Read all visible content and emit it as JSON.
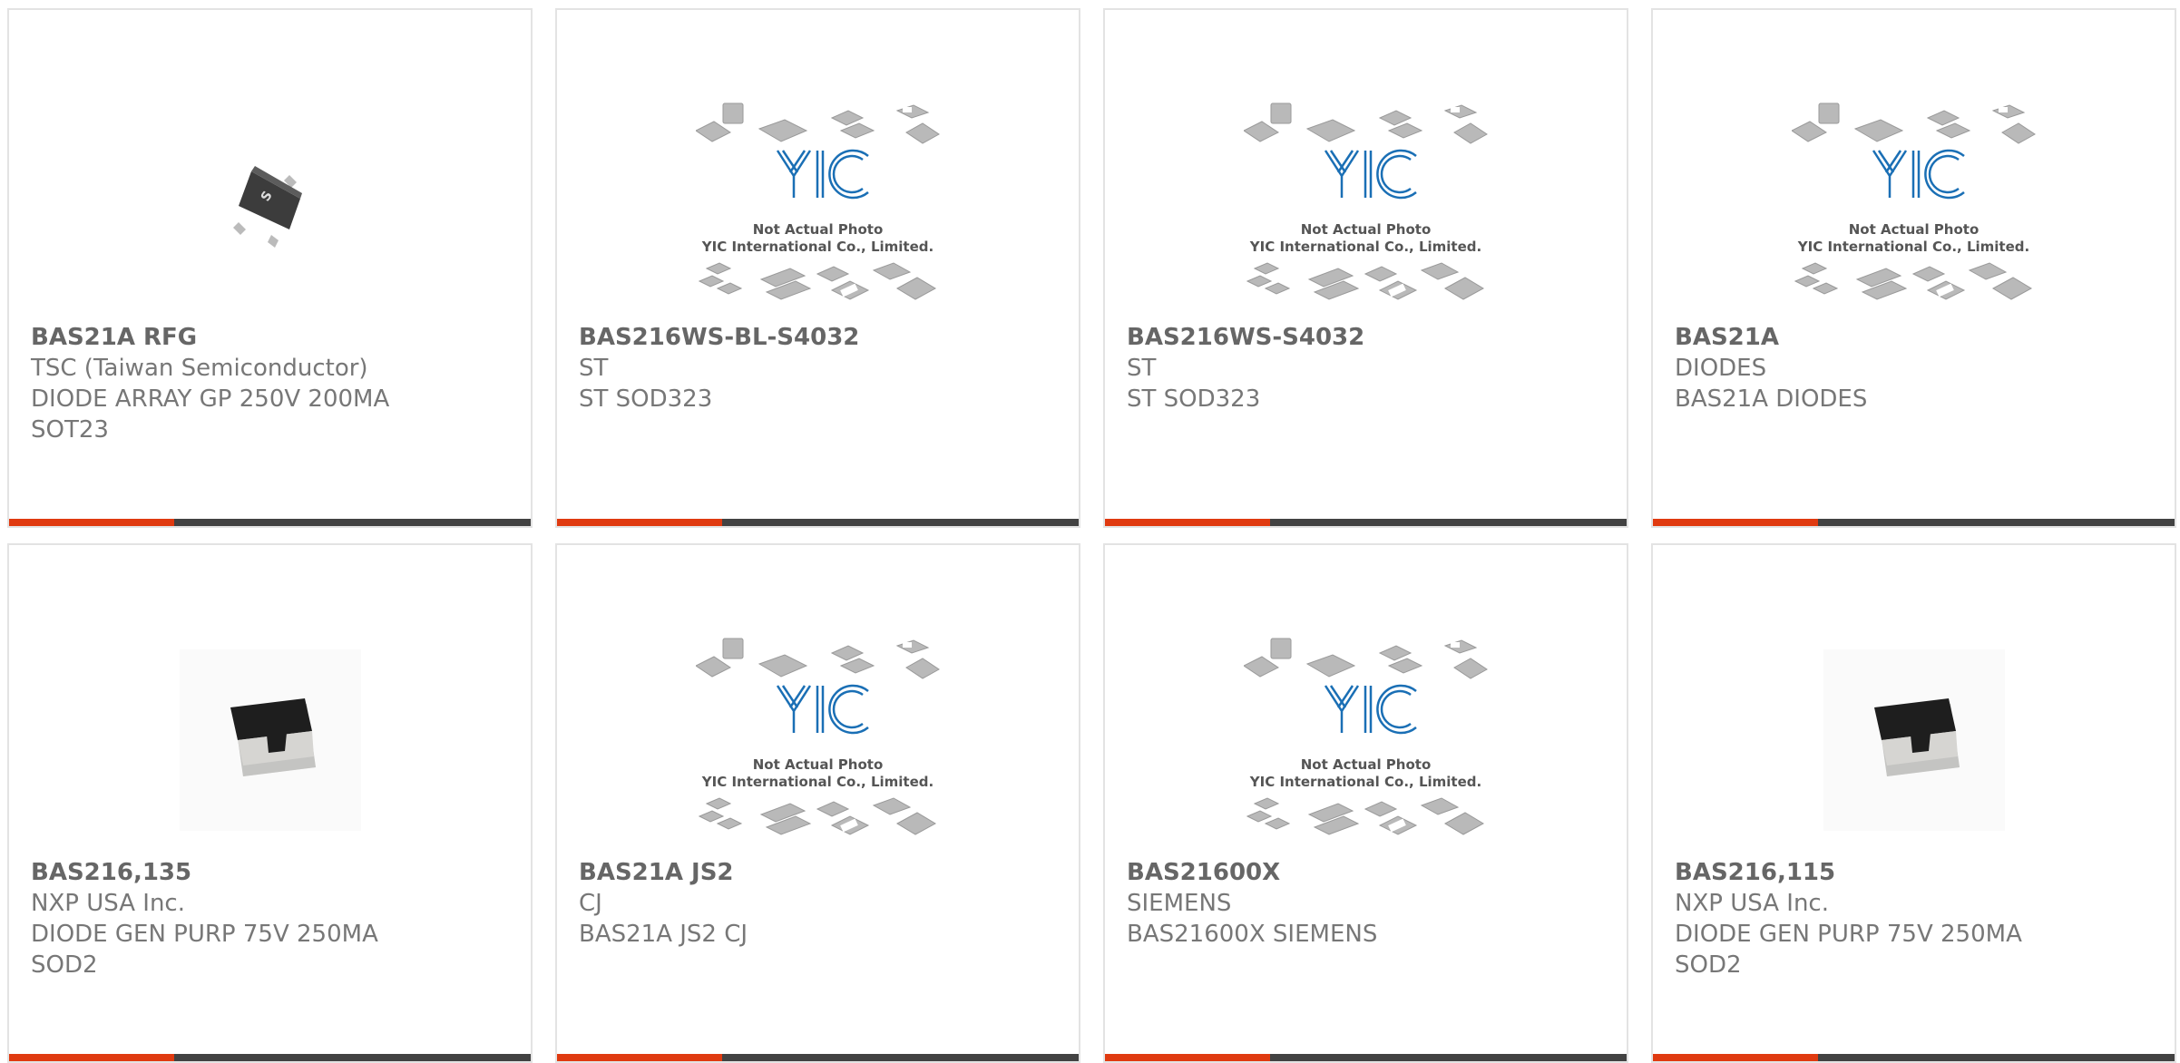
{
  "placeholder": {
    "line1": "Not Actual Photo",
    "line2": "YIC International Co., Limited.",
    "logo": "YIC"
  },
  "colors": {
    "accent": "#e03a10",
    "bar": "#424242",
    "logo": "#1a6fb5"
  },
  "products": [
    {
      "part_number": "BAS21A RFG",
      "manufacturer": "TSC (Taiwan Semiconductor)",
      "desc1": "DIODE ARRAY GP 250V 200MA",
      "desc2": "SOT23",
      "image": "sot23-package-photo"
    },
    {
      "part_number": "BAS216WS-BL-S4032",
      "manufacturer": "ST",
      "desc1": "ST SOD323",
      "desc2": "",
      "image": "yic-placeholder"
    },
    {
      "part_number": "BAS216WS-S4032",
      "manufacturer": "ST",
      "desc1": "ST SOD323",
      "desc2": "",
      "image": "yic-placeholder"
    },
    {
      "part_number": "BAS21A",
      "manufacturer": "DIODES",
      "desc1": "BAS21A DIODES",
      "desc2": "",
      "image": "yic-placeholder"
    },
    {
      "part_number": "BAS216,135",
      "manufacturer": "NXP USA Inc.",
      "desc1": "DIODE GEN PURP 75V 250MA",
      "desc2": "SOD2",
      "image": "sod2-package-photo"
    },
    {
      "part_number": "BAS21A JS2",
      "manufacturer": "CJ",
      "desc1": "BAS21A JS2 CJ",
      "desc2": "",
      "image": "yic-placeholder"
    },
    {
      "part_number": "BAS21600X",
      "manufacturer": "SIEMENS",
      "desc1": "BAS21600X SIEMENS",
      "desc2": "",
      "image": "yic-placeholder"
    },
    {
      "part_number": "BAS216,115",
      "manufacturer": "NXP USA Inc.",
      "desc1": "DIODE GEN PURP 75V 250MA",
      "desc2": "SOD2",
      "image": "sod2-package-photo"
    }
  ]
}
